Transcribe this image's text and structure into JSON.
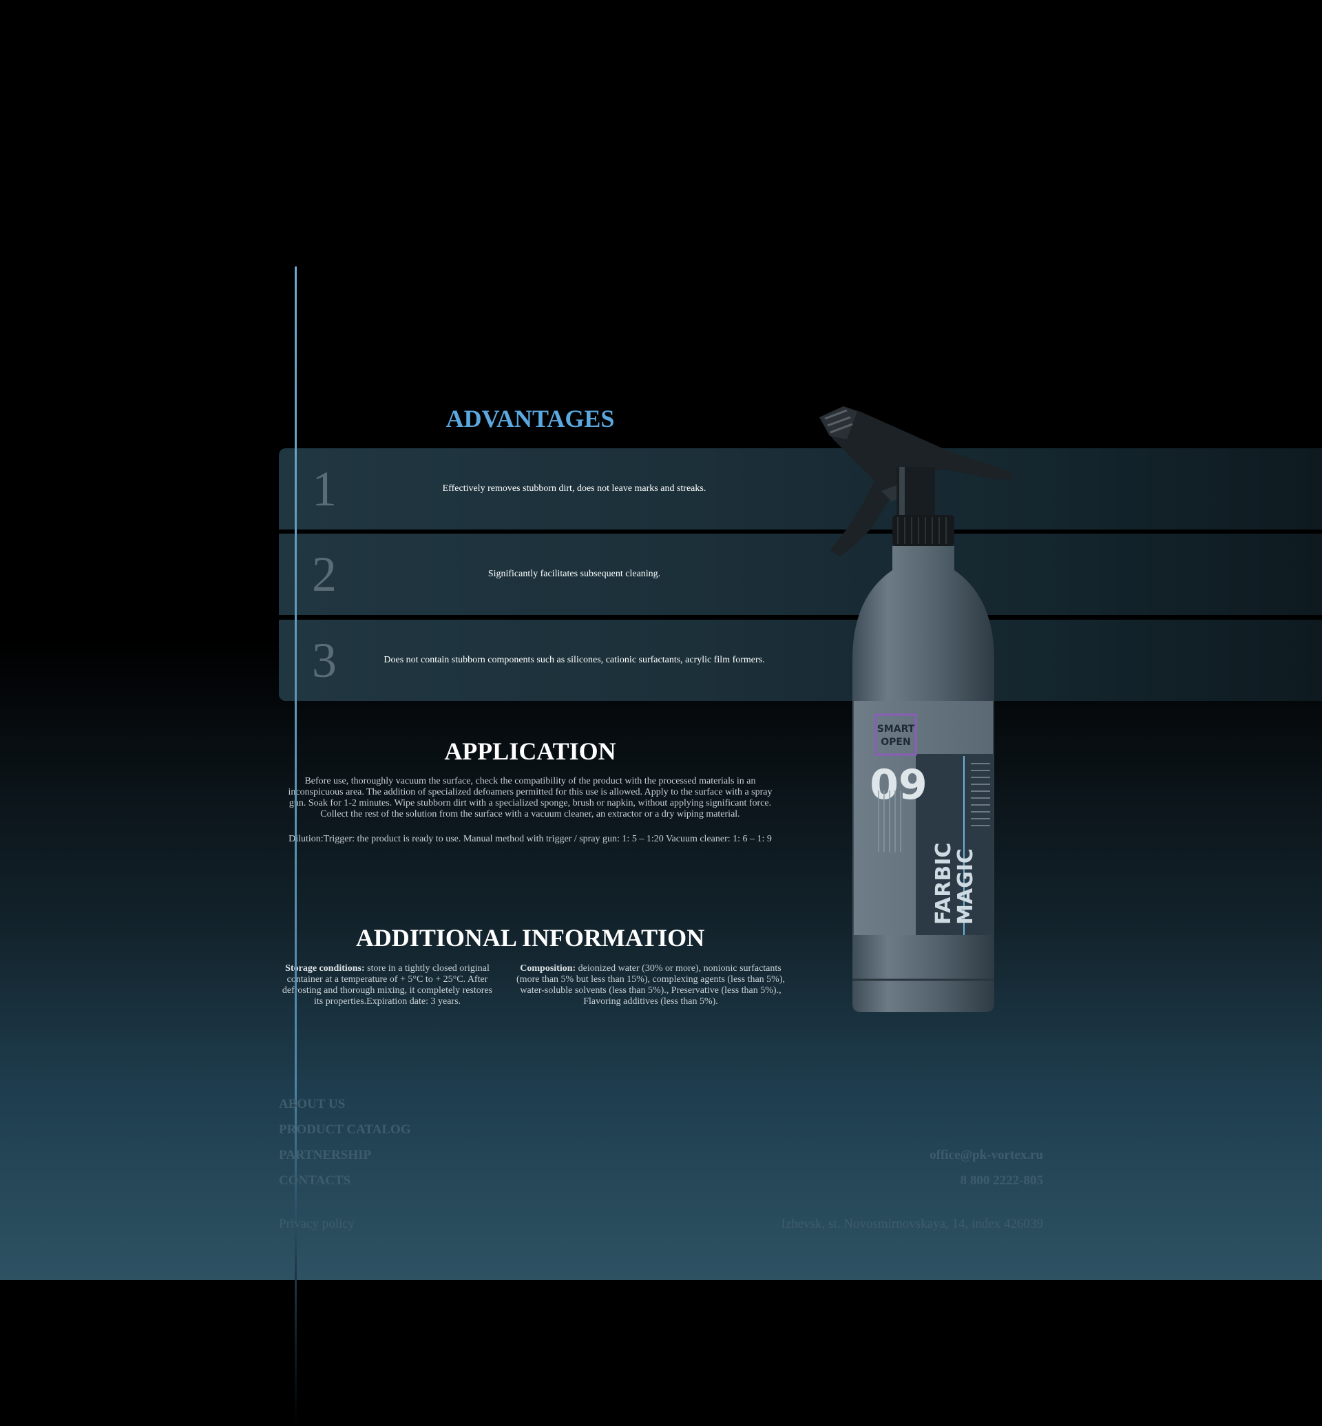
{
  "advantages": {
    "title": "ADVANTAGES",
    "items": [
      {
        "number": "1",
        "text": "Effectively removes stubborn dirt, does not leave marks and streaks."
      },
      {
        "number": "2",
        "text": "Significantly facilitates subsequent cleaning."
      },
      {
        "number": "3",
        "text": "Does not contain stubborn components such as silicones, cationic surfactants, acrylic film formers."
      }
    ]
  },
  "application": {
    "title": "APPLICATION",
    "text": "Before use, thoroughly vacuum the surface, check the compatibility of the product with the processed materials in an inconspicuous area. The addition of specialized defoamers permitted for this use is allowed. Apply to the surface with a spray gun. Soak for 1-2 minutes. Wipe stubborn dirt with a specialized sponge, brush or napkin, without applying significant force. Collect the rest of the solution from the surface with a vacuum cleaner, an extractor or a dry wiping material.",
    "dilution": "Dilution:Trigger: the product is ready to use. Manual method with trigger / spray gun: 1: 5 – 1:20 Vacuum cleaner: 1: 6 – 1: 9"
  },
  "additional": {
    "title": "ADDITIONAL INFORMATION",
    "storage_label": "Storage conditions:",
    "storage_text": " store in a tightly closed original container at a temperature of + 5°C to + 25°C. After defrosting and thorough mixing, it completely restores its properties.Expiration date: 3 years.",
    "composition_label": "Composition:",
    "composition_text": " deionized water (30% or more), nonionic surfactants (more than 5% but less than 15%), complexing agents (less than 5%), water-soluble solvents (less than 5%)., Preservative (less than 5%)., Flavoring additives (less than 5%)."
  },
  "product": {
    "brand_line1": "SMART",
    "brand_line2": "OPEN",
    "number": "09",
    "name_line1": "FARBIC",
    "name_line2": "MAGIC"
  },
  "footer": {
    "nav": [
      "ABOUT US",
      "PRODUCT CATALOG",
      "PARTNERSHIP",
      "CONTACTS"
    ],
    "privacy": "Privacy policy",
    "email": "office@pk-vortex.ru",
    "phone": "8 800 2222-805",
    "address": "Izhevsk, st. Novosmirnovskaya, 14, index 426039"
  },
  "colors": {
    "accent_blue": "#5ba8e0",
    "footer_text": "#3e5d6c",
    "row_bg": "#1c303a"
  }
}
